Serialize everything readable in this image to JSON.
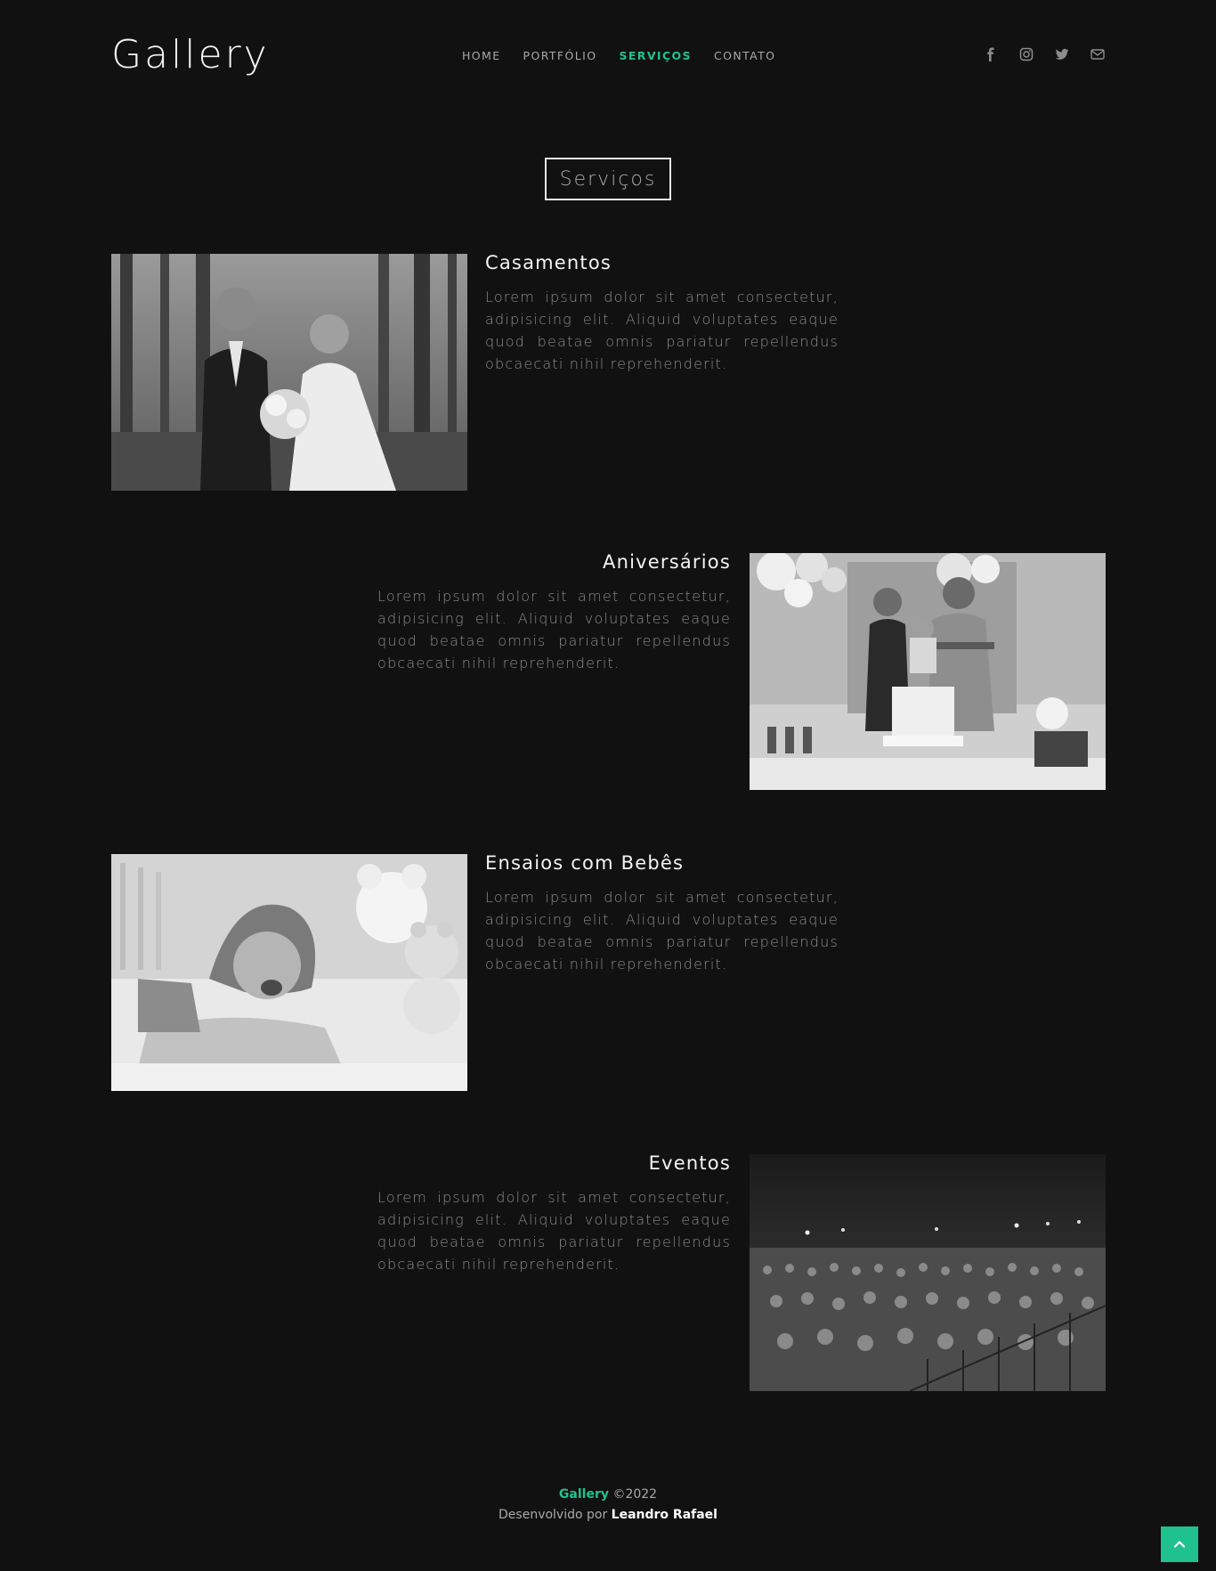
{
  "header": {
    "logo": "Gallery",
    "nav": [
      {
        "label": "HOME",
        "active": false
      },
      {
        "label": "PORTFÓLIO",
        "active": false
      },
      {
        "label": "SERVIÇOS",
        "active": true
      },
      {
        "label": "CONTATO",
        "active": false
      }
    ],
    "social_icons": [
      "facebook-icon",
      "instagram-icon",
      "twitter-icon",
      "envelope-icon"
    ]
  },
  "page_title": "Serviços",
  "services": [
    {
      "title": "Casamentos",
      "text": "Lorem ipsum dolor sit amet consectetur, adipisicing elit. Aliquid voluptates eaque quod beatae omnis pariatur repellendus obcaecati nihil reprehenderit.",
      "image_alt": "wedding couple photo"
    },
    {
      "title": "Aniversários",
      "text": "Lorem ipsum dolor sit amet consectetur, adipisicing elit. Aliquid voluptates eaque quod beatae omnis pariatur repellendus obcaecati nihil reprehenderit.",
      "image_alt": "family birthday photo"
    },
    {
      "title": "Ensaios com Bebês",
      "text": "Lorem ipsum dolor sit amet consectetur, adipisicing elit. Aliquid voluptates eaque quod beatae omnis pariatur repellendus obcaecati nihil reprehenderit.",
      "image_alt": "baby photo"
    },
    {
      "title": "Eventos",
      "text": "Lorem ipsum dolor sit amet consectetur, adipisicing elit. Aliquid voluptates eaque quod beatae omnis pariatur repellendus obcaecati nihil reprehenderit.",
      "image_alt": "concert crowd photo"
    }
  ],
  "footer": {
    "brand": "Gallery",
    "year": "©2022",
    "developed_by": "Desenvolvido por",
    "author": "Leandro Rafael"
  },
  "colors": {
    "accent": "#1fc28e",
    "background": "#111111"
  }
}
